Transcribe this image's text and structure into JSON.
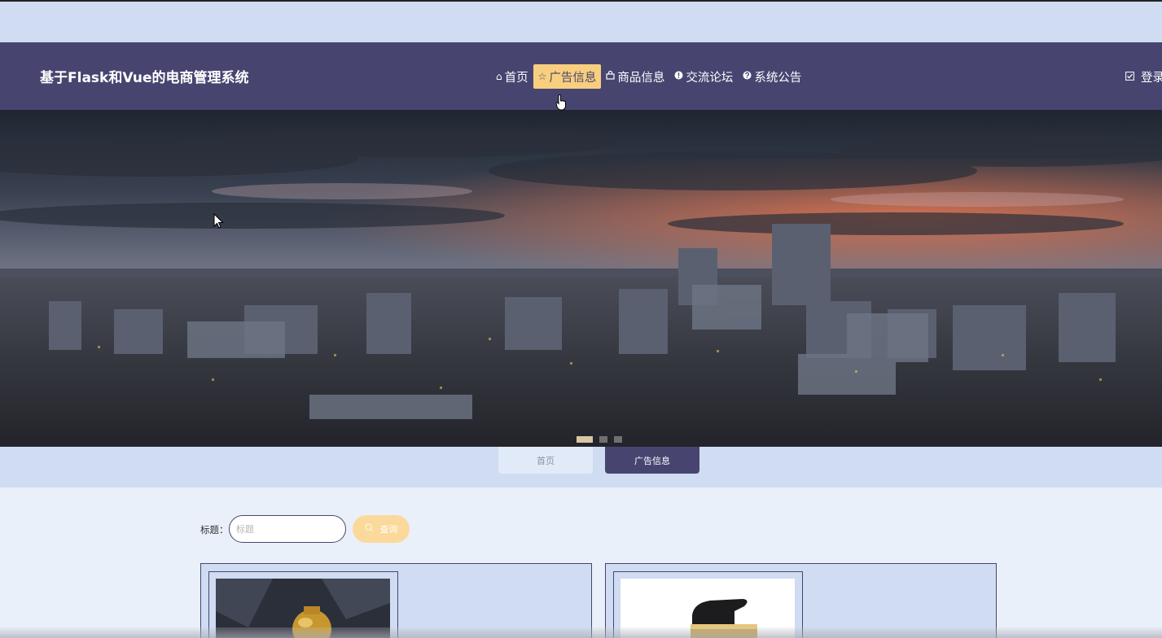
{
  "navbar": {
    "brand": "基于Flask和Vue的电商管理系统",
    "menu": [
      {
        "label": "首页",
        "icon": "home-icon"
      },
      {
        "label": "广告信息",
        "icon": "star-icon",
        "active": true
      },
      {
        "label": "商品信息",
        "icon": "bag-icon"
      },
      {
        "label": "交流论坛",
        "icon": "info-icon"
      },
      {
        "label": "系统公告",
        "icon": "question-icon"
      }
    ],
    "login_label": "登录",
    "login_icon": "checkbox-icon"
  },
  "banner": {
    "slide_count": 3,
    "active_slide": 1
  },
  "breadcrumb_tabs": [
    {
      "label": "首页",
      "active": false
    },
    {
      "label": "广告信息",
      "active": true
    }
  ],
  "search": {
    "label": "标题：",
    "placeholder": "标题",
    "value": "",
    "button_label": "查询",
    "button_icon": "search-icon"
  },
  "colors": {
    "navbar_bg": "#474570",
    "accent": "#f8cf7f",
    "page_bg": "#cfdcf2",
    "content_bg": "#eaf0fa"
  }
}
